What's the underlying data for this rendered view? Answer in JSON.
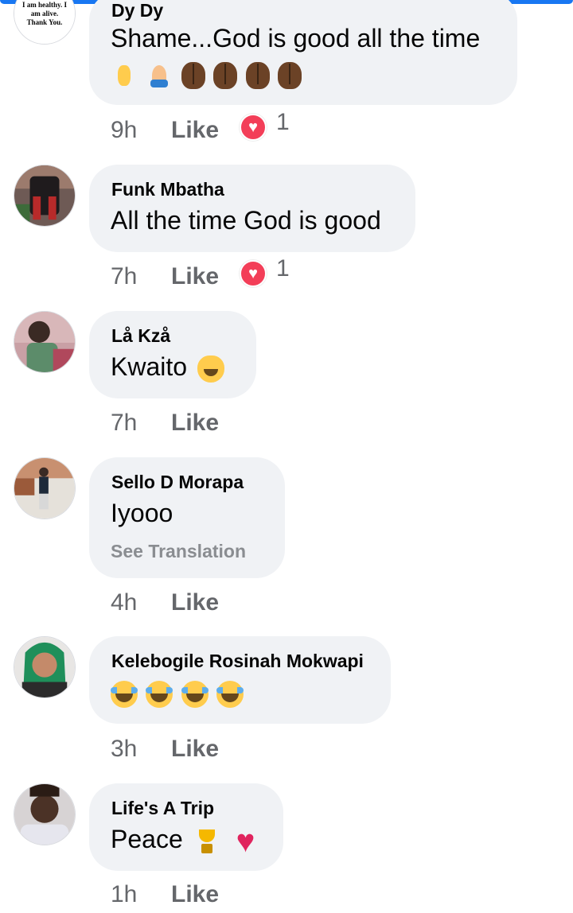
{
  "comments": [
    {
      "author": "Dy Dy",
      "avatar_text": "I am healthy. I am alive. Thank You.",
      "text": "Shame...God is good all the time",
      "emojis": [
        "crossed-fingers",
        "folded-hands",
        "clapping-hands",
        "clapping-hands",
        "clapping-hands",
        "clapping-hands"
      ],
      "time": "9h",
      "like_label": "Like",
      "reaction": {
        "type": "love-icon",
        "count": "1"
      }
    },
    {
      "author": "Funk Mbatha",
      "text": "All the time God is good",
      "time": "7h",
      "like_label": "Like",
      "reaction": {
        "type": "love-icon",
        "count": "1"
      }
    },
    {
      "author": "Lå Kzå",
      "text": "Kwaito",
      "emojis": [
        "cat-tears-of-joy"
      ],
      "time": "7h",
      "like_label": "Like"
    },
    {
      "author": "Sello D Morapa",
      "text": "Iyooo",
      "see_translation": "See Translation",
      "time": "4h",
      "like_label": "Like"
    },
    {
      "author": "Kelebogile Rosinah Mokwapi",
      "emojis": [
        "tears-of-joy",
        "tears-of-joy",
        "tears-of-joy",
        "loudly-crying"
      ],
      "time": "3h",
      "like_label": "Like"
    },
    {
      "author": "Life's A Trip",
      "text": "Peace",
      "emojis": [
        "trophy",
        "red-heart"
      ],
      "time": "1h",
      "like_label": "Like"
    }
  ],
  "colors": {
    "bubble": "#f0f2f5",
    "meta_text": "#65676b",
    "love_reaction": "#f33e58",
    "accent": "#1877f2"
  }
}
